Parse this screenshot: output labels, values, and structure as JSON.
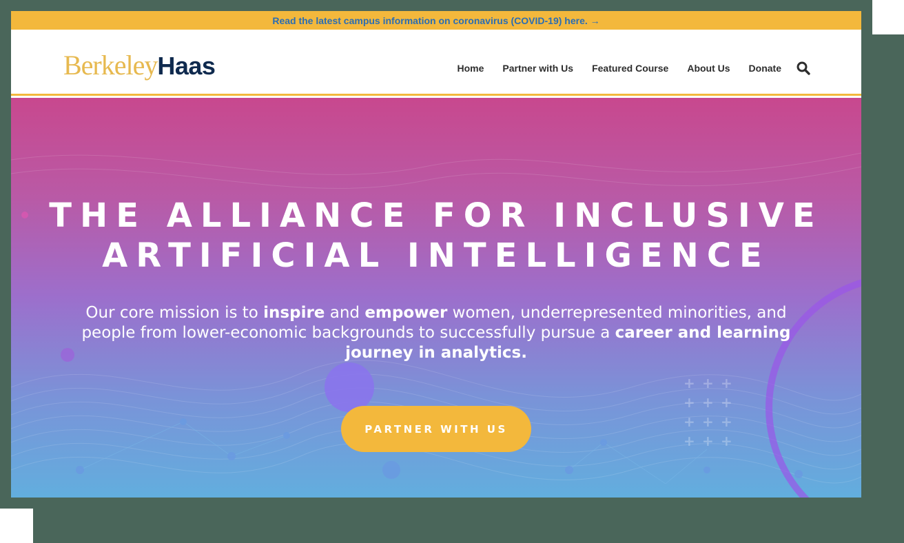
{
  "alert": {
    "text": "Read the latest campus information on coronavirus (COVID-19) here. →"
  },
  "logo": {
    "part1": "Berkeley",
    "part2": "Haas"
  },
  "nav": {
    "items": [
      "Home",
      "Partner with Us",
      "Featured Course",
      "About Us",
      "Donate"
    ],
    "search_icon": "search-icon"
  },
  "hero": {
    "title_line1": "THE ALLIANCE FOR INCLUSIVE",
    "title_line2": "ARTIFICIAL INTELLIGENCE",
    "mission": {
      "p1": "Our core mission is to ",
      "b1": "inspire",
      "p2": " and ",
      "b2": "empower",
      "p3": " women, underrepresented minorities, and people from lower-economic backgrounds to successfully pursue a ",
      "b3": "career and learning journey in analytics."
    },
    "cta_label": "PARTNER WITH US"
  },
  "colors": {
    "accent_gold": "#f3b83c",
    "link_blue": "#2a6db3",
    "navy": "#0f2a4e",
    "backdrop": "#4a665a"
  }
}
